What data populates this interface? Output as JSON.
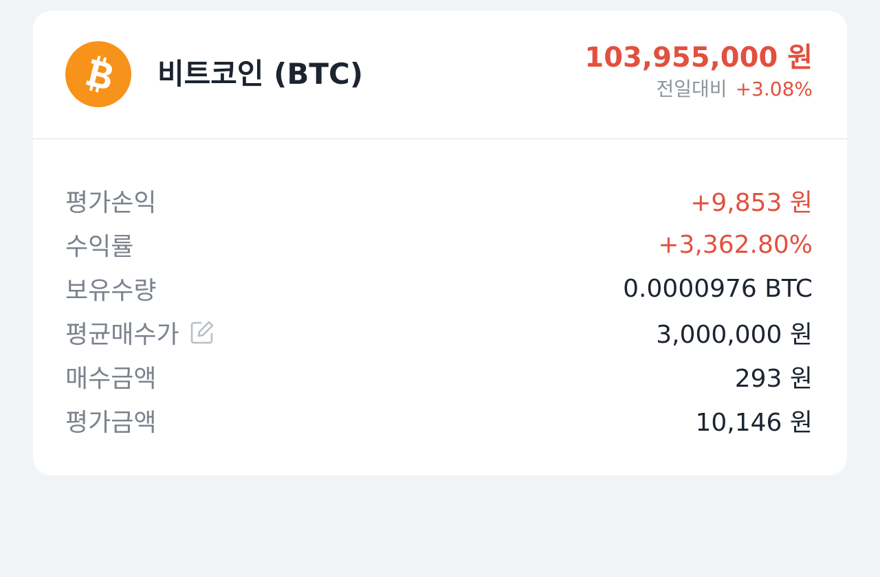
{
  "coin": {
    "name": "비트코인 (BTC)",
    "logo_icon": "bitcoin-icon",
    "logo_color": "#f7931a",
    "price": "103,955,000 원",
    "change_label": "전일대비",
    "change_value": "+3.08%"
  },
  "rows": [
    {
      "label": "평가손익",
      "value": "+9,853 원",
      "tone": "positive"
    },
    {
      "label": "수익률",
      "value": "+3,362.80%",
      "tone": "positive"
    },
    {
      "label": "보유수량",
      "value": "0.0000976 BTC",
      "tone": "neutral"
    },
    {
      "label": "평균매수가",
      "value": "3,000,000 원",
      "tone": "neutral",
      "action_icon": "edit-icon"
    },
    {
      "label": "매수금액",
      "value": "293 원",
      "tone": "neutral"
    },
    {
      "label": "평가금액",
      "value": "10,146 원",
      "tone": "neutral"
    }
  ],
  "colors": {
    "positive": "#e2503f",
    "text": "#1c2430",
    "muted": "#7a828c",
    "background": "#f1f4f7",
    "card": "#ffffff"
  }
}
